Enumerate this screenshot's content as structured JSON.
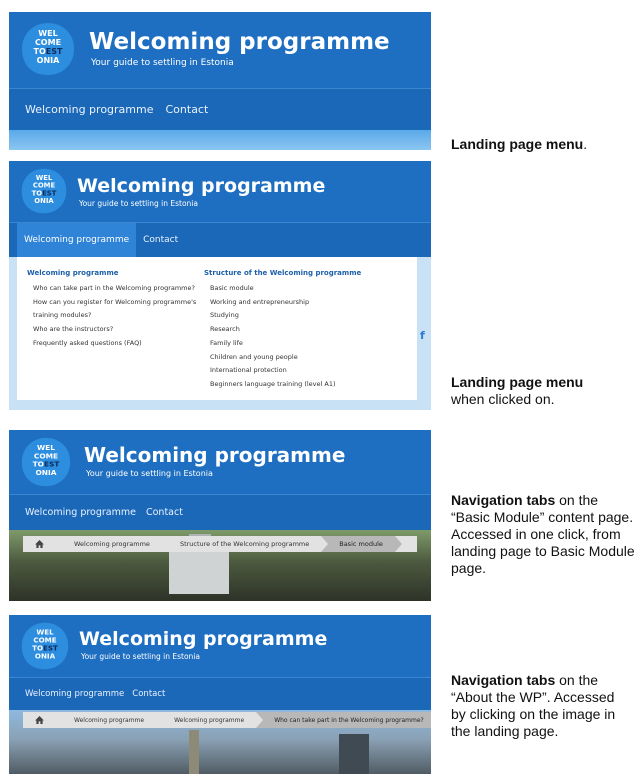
{
  "site": {
    "logo_lines": [
      "WEL",
      "COME",
      "TO",
      "EST",
      "ONIA"
    ],
    "title": "Welcoming programme",
    "subtitle": "Your guide to settling in Estonia"
  },
  "nav": {
    "item1": "Welcoming programme",
    "item2": "Contact"
  },
  "captions": {
    "c1_bold": "Landing page menu",
    "c1_rest": ".",
    "c2_bold": "Landing page menu",
    "c2_rest": "when clicked on.",
    "c3_bold": "Navigation tabs",
    "c3_rest": " on the “Basic Module” content page. Accessed in one click, from landing page to Basic Module page.",
    "c4_bold": "Navigation tabs",
    "c4_rest": " on the “About the WP”. Accessed by clicking on the image in the landing page."
  },
  "dropdown": {
    "col1_heading": "Welcoming programme",
    "col1_links": [
      "Who can take part in the Welcoming programme?",
      "How can you register for Welcoming programme's",
      "training modules?",
      "Who are the instructors?",
      "Frequently asked questions (FAQ)"
    ],
    "col2_heading": "Structure of the Welcoming programme",
    "col2_links": [
      "Basic module",
      "Working and entrepreneurship",
      "Studying",
      "Research",
      "Family life",
      "Children and young people",
      "International protection",
      "Beginners language training (level A1)"
    ],
    "social_letter": "f"
  },
  "breadcrumbs3": [
    "Welcoming programme",
    "Structure of the Welcoming programme",
    "Basic module"
  ],
  "breadcrumbs4": [
    "Welcoming programme",
    "Welcoming programme",
    "Who can take part in the Welcoming programme?"
  ],
  "icons": {
    "home": "home-icon",
    "logo": "welcome-to-estonia-logo"
  },
  "colors": {
    "header_blue": "#1e6fc1",
    "nav_blue": "#1b68b8",
    "active_tab": "#2f84d8",
    "link_blue": "#1d5fa8"
  }
}
